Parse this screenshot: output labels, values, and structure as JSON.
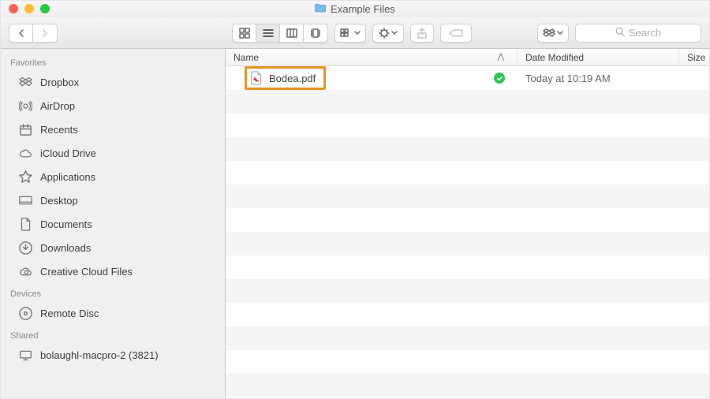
{
  "window": {
    "title": "Example Files"
  },
  "toolbar": {
    "search_placeholder": "Search"
  },
  "sidebar": {
    "sections": [
      {
        "header": "Favorites",
        "items": [
          {
            "label": "Dropbox",
            "icon": "dropbox-icon"
          },
          {
            "label": "AirDrop",
            "icon": "airdrop-icon"
          },
          {
            "label": "Recents",
            "icon": "recents-icon"
          },
          {
            "label": "iCloud Drive",
            "icon": "cloud-icon"
          },
          {
            "label": "Applications",
            "icon": "applications-icon"
          },
          {
            "label": "Desktop",
            "icon": "desktop-icon"
          },
          {
            "label": "Documents",
            "icon": "documents-icon"
          },
          {
            "label": "Downloads",
            "icon": "downloads-icon"
          },
          {
            "label": "Creative Cloud Files",
            "icon": "creative-cloud-icon"
          }
        ]
      },
      {
        "header": "Devices",
        "items": [
          {
            "label": "Remote Disc",
            "icon": "disc-icon"
          }
        ]
      },
      {
        "header": "Shared",
        "items": [
          {
            "label": "bolaughl-macpro-2 (3821)",
            "icon": "computer-icon"
          }
        ]
      }
    ]
  },
  "columns": {
    "name": "Name",
    "date": "Date Modified",
    "size": "Size"
  },
  "files": [
    {
      "name": "Bodea.pdf",
      "date": "Today at 10:19 AM",
      "synced": true,
      "highlighted": true
    }
  ]
}
